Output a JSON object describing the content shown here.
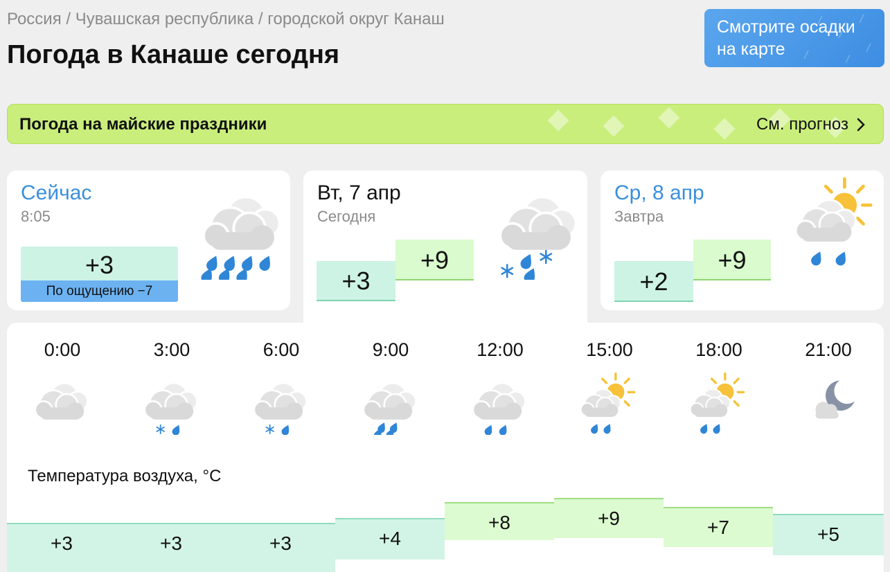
{
  "breadcrumb": "Россия / Чувашская республика / городской округ Канаш",
  "page_title": "Погода в Канаше сегодня",
  "map_button": "Смотрите осадки на карте",
  "promo": {
    "title": "Погода на майские праздники",
    "link": "См. прогноз"
  },
  "now": {
    "title": "Сейчас",
    "time": "8:05",
    "temp": "+3",
    "feels_like": "По ощущению −7",
    "icon": "cloud-rain-icon"
  },
  "today": {
    "title": "Вт, 7 апр",
    "sub": "Сегодня",
    "min": "+3",
    "max": "+9",
    "icon": "cloud-snow-rain-icon"
  },
  "tomorrow": {
    "title": "Ср, 8 апр",
    "sub": "Завтра",
    "min": "+2",
    "max": "+9",
    "icon": "sun-cloud-rain-icon"
  },
  "hourly": {
    "label": "Температура воздуха, °C",
    "hours": [
      "0:00",
      "3:00",
      "6:00",
      "9:00",
      "12:00",
      "15:00",
      "18:00",
      "21:00"
    ],
    "temps": [
      "+3",
      "+3",
      "+3",
      "+4",
      "+8",
      "+9",
      "+7",
      "+5"
    ],
    "icons": [
      "cloud-icon",
      "cloud-snow-rain-icon",
      "cloud-snow-rain-icon",
      "cloud-rain-icon",
      "cloud-rain-icon",
      "sun-cloud-rain-icon",
      "sun-cloud-rain-icon",
      "moon-cloud-icon"
    ]
  },
  "colors": {
    "link_blue": "#3b8fdc",
    "promo_green": "#c9ee7c",
    "cold_fill": "#cdf3e4",
    "warm_fill": "#d9fbcd",
    "feel_bar": "#6cb2f1"
  }
}
